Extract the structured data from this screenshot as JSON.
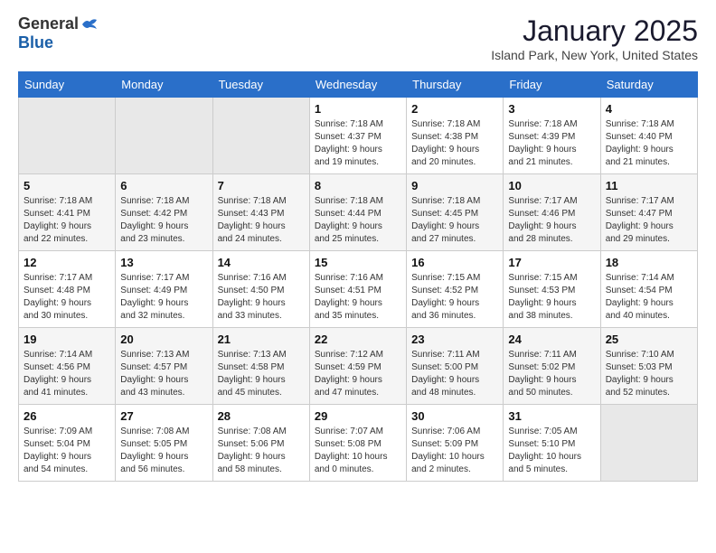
{
  "logo": {
    "general": "General",
    "blue": "Blue"
  },
  "title": "January 2025",
  "location": "Island Park, New York, United States",
  "days_of_week": [
    "Sunday",
    "Monday",
    "Tuesday",
    "Wednesday",
    "Thursday",
    "Friday",
    "Saturday"
  ],
  "weeks": [
    [
      {
        "day": "",
        "info": ""
      },
      {
        "day": "",
        "info": ""
      },
      {
        "day": "",
        "info": ""
      },
      {
        "day": "1",
        "info": "Sunrise: 7:18 AM\nSunset: 4:37 PM\nDaylight: 9 hours\nand 19 minutes."
      },
      {
        "day": "2",
        "info": "Sunrise: 7:18 AM\nSunset: 4:38 PM\nDaylight: 9 hours\nand 20 minutes."
      },
      {
        "day": "3",
        "info": "Sunrise: 7:18 AM\nSunset: 4:39 PM\nDaylight: 9 hours\nand 21 minutes."
      },
      {
        "day": "4",
        "info": "Sunrise: 7:18 AM\nSunset: 4:40 PM\nDaylight: 9 hours\nand 21 minutes."
      }
    ],
    [
      {
        "day": "5",
        "info": "Sunrise: 7:18 AM\nSunset: 4:41 PM\nDaylight: 9 hours\nand 22 minutes."
      },
      {
        "day": "6",
        "info": "Sunrise: 7:18 AM\nSunset: 4:42 PM\nDaylight: 9 hours\nand 23 minutes."
      },
      {
        "day": "7",
        "info": "Sunrise: 7:18 AM\nSunset: 4:43 PM\nDaylight: 9 hours\nand 24 minutes."
      },
      {
        "day": "8",
        "info": "Sunrise: 7:18 AM\nSunset: 4:44 PM\nDaylight: 9 hours\nand 25 minutes."
      },
      {
        "day": "9",
        "info": "Sunrise: 7:18 AM\nSunset: 4:45 PM\nDaylight: 9 hours\nand 27 minutes."
      },
      {
        "day": "10",
        "info": "Sunrise: 7:17 AM\nSunset: 4:46 PM\nDaylight: 9 hours\nand 28 minutes."
      },
      {
        "day": "11",
        "info": "Sunrise: 7:17 AM\nSunset: 4:47 PM\nDaylight: 9 hours\nand 29 minutes."
      }
    ],
    [
      {
        "day": "12",
        "info": "Sunrise: 7:17 AM\nSunset: 4:48 PM\nDaylight: 9 hours\nand 30 minutes."
      },
      {
        "day": "13",
        "info": "Sunrise: 7:17 AM\nSunset: 4:49 PM\nDaylight: 9 hours\nand 32 minutes."
      },
      {
        "day": "14",
        "info": "Sunrise: 7:16 AM\nSunset: 4:50 PM\nDaylight: 9 hours\nand 33 minutes."
      },
      {
        "day": "15",
        "info": "Sunrise: 7:16 AM\nSunset: 4:51 PM\nDaylight: 9 hours\nand 35 minutes."
      },
      {
        "day": "16",
        "info": "Sunrise: 7:15 AM\nSunset: 4:52 PM\nDaylight: 9 hours\nand 36 minutes."
      },
      {
        "day": "17",
        "info": "Sunrise: 7:15 AM\nSunset: 4:53 PM\nDaylight: 9 hours\nand 38 minutes."
      },
      {
        "day": "18",
        "info": "Sunrise: 7:14 AM\nSunset: 4:54 PM\nDaylight: 9 hours\nand 40 minutes."
      }
    ],
    [
      {
        "day": "19",
        "info": "Sunrise: 7:14 AM\nSunset: 4:56 PM\nDaylight: 9 hours\nand 41 minutes."
      },
      {
        "day": "20",
        "info": "Sunrise: 7:13 AM\nSunset: 4:57 PM\nDaylight: 9 hours\nand 43 minutes."
      },
      {
        "day": "21",
        "info": "Sunrise: 7:13 AM\nSunset: 4:58 PM\nDaylight: 9 hours\nand 45 minutes."
      },
      {
        "day": "22",
        "info": "Sunrise: 7:12 AM\nSunset: 4:59 PM\nDaylight: 9 hours\nand 47 minutes."
      },
      {
        "day": "23",
        "info": "Sunrise: 7:11 AM\nSunset: 5:00 PM\nDaylight: 9 hours\nand 48 minutes."
      },
      {
        "day": "24",
        "info": "Sunrise: 7:11 AM\nSunset: 5:02 PM\nDaylight: 9 hours\nand 50 minutes."
      },
      {
        "day": "25",
        "info": "Sunrise: 7:10 AM\nSunset: 5:03 PM\nDaylight: 9 hours\nand 52 minutes."
      }
    ],
    [
      {
        "day": "26",
        "info": "Sunrise: 7:09 AM\nSunset: 5:04 PM\nDaylight: 9 hours\nand 54 minutes."
      },
      {
        "day": "27",
        "info": "Sunrise: 7:08 AM\nSunset: 5:05 PM\nDaylight: 9 hours\nand 56 minutes."
      },
      {
        "day": "28",
        "info": "Sunrise: 7:08 AM\nSunset: 5:06 PM\nDaylight: 9 hours\nand 58 minutes."
      },
      {
        "day": "29",
        "info": "Sunrise: 7:07 AM\nSunset: 5:08 PM\nDaylight: 10 hours\nand 0 minutes."
      },
      {
        "day": "30",
        "info": "Sunrise: 7:06 AM\nSunset: 5:09 PM\nDaylight: 10 hours\nand 2 minutes."
      },
      {
        "day": "31",
        "info": "Sunrise: 7:05 AM\nSunset: 5:10 PM\nDaylight: 10 hours\nand 5 minutes."
      },
      {
        "day": "",
        "info": ""
      }
    ]
  ]
}
